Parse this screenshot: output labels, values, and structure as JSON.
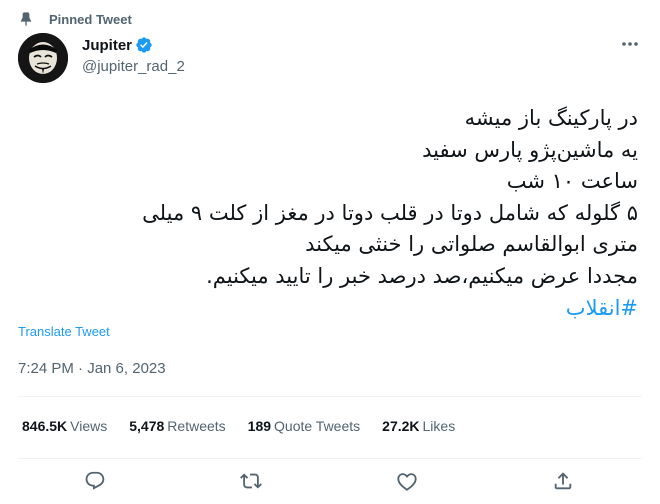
{
  "pinned": {
    "label": "Pinned Tweet"
  },
  "author": {
    "name": "Jupiter",
    "handle": "@jupiter_rad_2"
  },
  "tweet": {
    "lines": [
      "در پارکینگ باز میشه",
      "یه ماشین‌پژو پارس سفید",
      "ساعت ۱۰ شب",
      "۵ گلوله که شامل دوتا در قلب دوتا در مغز از کلت ۹ میلی",
      "متری ابوالقاسم صلواتی را خنثی میکند",
      "مجددا عرض میکنیم،صد درصد خبر را تایید میکنیم."
    ],
    "hashtag": "#انقلاب"
  },
  "translate_label": "Translate Tweet",
  "timestamp": "7:24 PM · Jan 6, 2023",
  "stats": {
    "views": {
      "count": "846.5K",
      "label": "Views"
    },
    "retweets": {
      "count": "5,478",
      "label": "Retweets"
    },
    "quotes": {
      "count": "189",
      "label": "Quote Tweets"
    },
    "likes": {
      "count": "27.2K",
      "label": "Likes"
    }
  },
  "icons": {
    "pin": "pin-icon",
    "verified": "verified-badge-icon",
    "more": "more-options-icon",
    "reply": "reply-icon",
    "retweet": "retweet-icon",
    "like": "like-icon",
    "share": "share-icon"
  },
  "colors": {
    "accent": "#1d9bf0",
    "secondary_text": "#536471",
    "divider": "#eff3f4"
  }
}
